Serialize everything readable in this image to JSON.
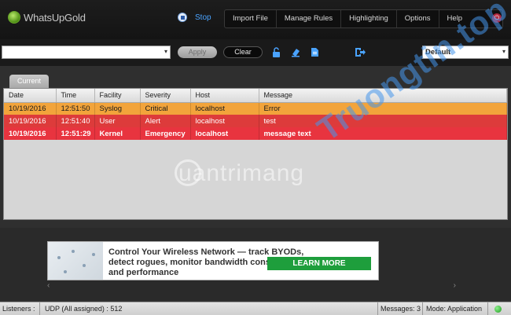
{
  "app": {
    "logo_text": "WhatsUpGold",
    "stop_label": "Stop"
  },
  "menu": [
    "Import File",
    "Manage Rules",
    "Highlighting",
    "Options",
    "Help"
  ],
  "filter": {
    "select_value": "",
    "apply_label": "Apply",
    "clear_label": "Clear",
    "icons": [
      "unlock-icon",
      "eraser-icon",
      "document-icon",
      "export-icon"
    ],
    "view_select": "Default"
  },
  "tab_label": "Current",
  "table": {
    "columns": [
      "Date",
      "Time",
      "Facility",
      "Severity",
      "Host",
      "Message"
    ],
    "rows": [
      {
        "date": "10/19/2016",
        "time": "12:51:50",
        "facility": "Syslog",
        "severity": "Critical",
        "host": "localhost",
        "message": "Error",
        "color": "#f2a43b"
      },
      {
        "date": "10/19/2016",
        "time": "12:51:40",
        "facility": "User",
        "severity": "Alert",
        "host": "localhost",
        "message": "test",
        "color": "#dd3b3b"
      },
      {
        "date": "10/19/2016",
        "time": "12:51:29",
        "facility": "Kernel",
        "severity": "Emergency",
        "host": "localhost",
        "message": "message text",
        "color": "#e8343f"
      }
    ]
  },
  "ad": {
    "text": "Control Your Wireless Network — track BYODs, detect rogues, monitor bandwidth consumption and performance",
    "button": "LEARN MORE"
  },
  "status": {
    "listeners_label": "Listeners :",
    "listeners_value": "UDP  (All assigned) : 512",
    "messages": "Messages: 3",
    "mode": "Mode: Application"
  },
  "watermarks": {
    "quantrimang": "uantrimang",
    "truongtin": "Truongtin.top"
  },
  "colors": {
    "accent_blue": "#4aa3ff",
    "row_orange": "#f2a43b",
    "row_red": "#dd3b3b",
    "learn_green": "#1e9e3c"
  }
}
